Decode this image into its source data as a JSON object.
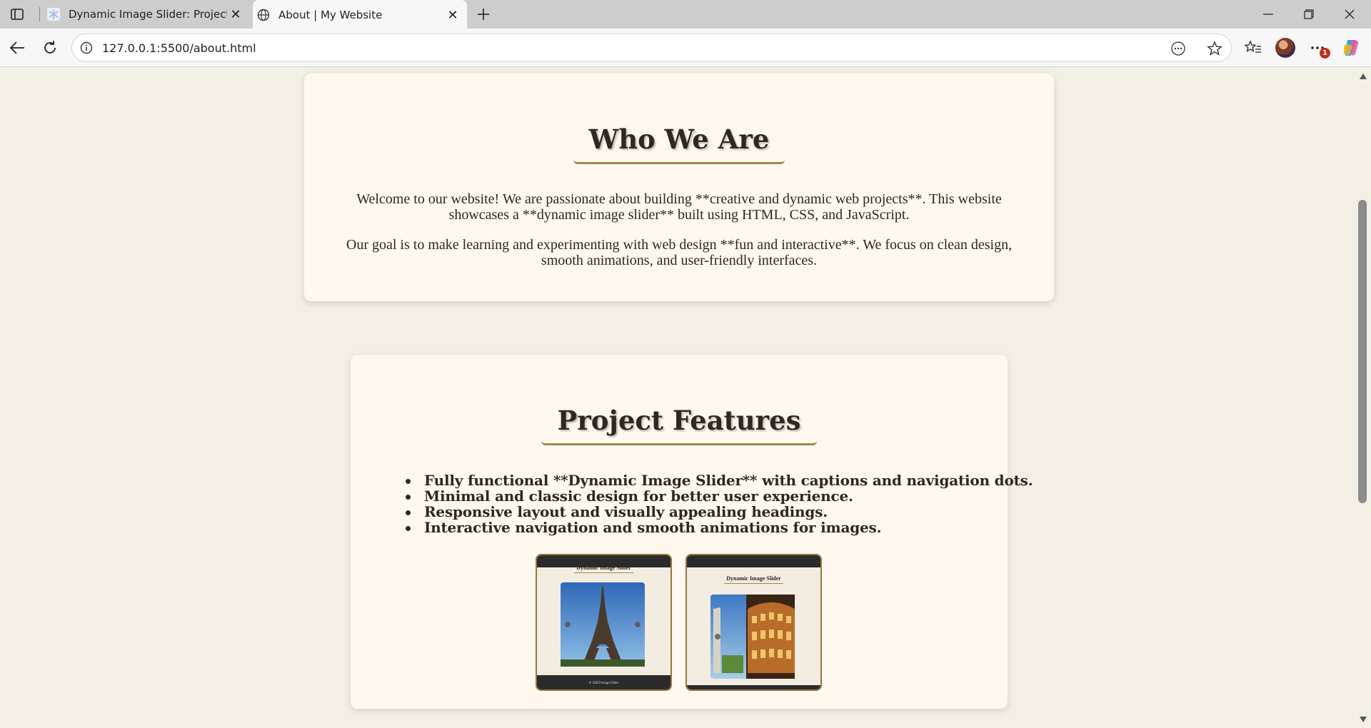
{
  "browser": {
    "tabs": [
      {
        "title": "Dynamic Image Slider: Project Ph",
        "active": false
      },
      {
        "title": "About | My Website",
        "active": true
      }
    ],
    "url": "127.0.0.1:5500/about.html",
    "notification_count": "1"
  },
  "colors": {
    "page_bg": "#f3efe5",
    "card_bg": "#fff8ef",
    "heading_underline": "#a8864a",
    "text": "#2e2722"
  },
  "about": {
    "heading": "Who We Are",
    "paragraph_1": "Welcome to our website! We are passionate about building **creative and dynamic web projects**. This website showcases a **dynamic image slider** built using HTML, CSS, and JavaScript.",
    "paragraph_2": "Our goal is to make learning and experimenting with web design **fun and interactive**. We focus on clean design, smooth animations, and user-friendly interfaces."
  },
  "features": {
    "heading": "Project Features",
    "items": [
      "Fully functional **Dynamic Image Slider** with captions and navigation dots.",
      "Minimal and classic design for better user experience.",
      "Responsive layout and visually appealing headings.",
      "Interactive navigation and smooth animations for images."
    ],
    "screenshots": [
      {
        "title": "Dynamic Image Slider",
        "footer_text": "© 2025 Image Slider"
      },
      {
        "title": "Dynamic Image Slider"
      }
    ]
  }
}
